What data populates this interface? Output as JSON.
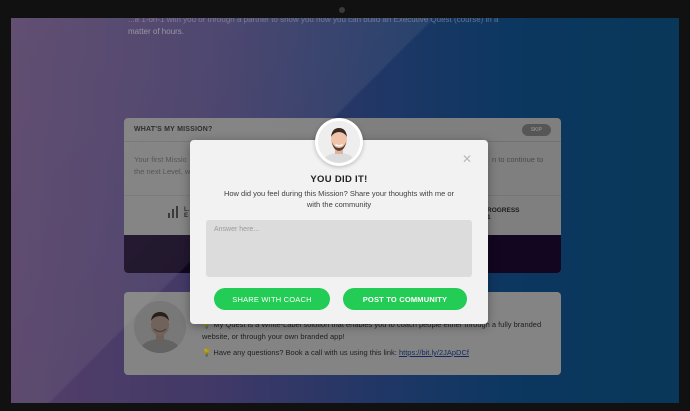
{
  "top_text": "matter of hours.",
  "top_text_partial": "...a 1-on-1 with you or through a partner to show you how you can build an Executive Quest (course) in a",
  "mission": {
    "title": "WHAT'S MY MISSION?",
    "skip": "SKIP",
    "desc_left": "Your first Missio\nthe next Level, w",
    "desc_right": "n to continue to",
    "stat_left": "L…\nE",
    "stat_right": "ROGRESS\n1"
  },
  "coach": {
    "line1": "💡 My Quest is a White-Label solution that enables you to coach people either through a fully branded website, or through your own branded app!",
    "line2_prefix": "💡 Have any questions? Book a call with us using this link: ",
    "link": "https://bit.ly/2JApDCf"
  },
  "modal": {
    "title": "YOU DID IT!",
    "subtitle": "How did you feel during this Mission? Share your thoughts with me or with the community",
    "answer_placeholder": "Answer here...",
    "share_button": "SHARE WITH COACH",
    "post_button": "POST TO COMMUNITY",
    "close_icon": "close-icon"
  },
  "colors": {
    "accent_green": "#22cc55",
    "modal_bg": "#f2f2f2"
  }
}
